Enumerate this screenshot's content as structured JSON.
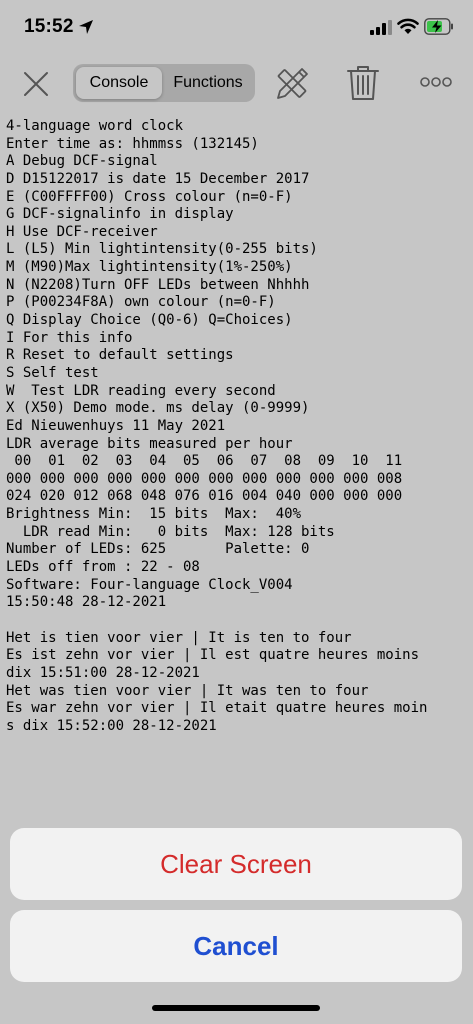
{
  "status": {
    "time": "15:52"
  },
  "toolbar": {
    "tabs": [
      {
        "label": "Console"
      },
      {
        "label": "Functions"
      }
    ],
    "icons": [
      "close-icon",
      "ruler-pencil-icon",
      "trash-icon",
      "more-icon"
    ]
  },
  "console": {
    "lines": [
      "4-language word clock",
      "Enter time as: hhmmss (132145)",
      "A Debug DCF-signal",
      "D D15122017 is date 15 December 2017",
      "E (C00FFFF00) Cross colour (n=0-F)",
      "G DCF-signalinfo in display",
      "H Use DCF-receiver",
      "L (L5) Min lightintensity(0-255 bits)",
      "M (M90)Max lightintensity(1%-250%)",
      "N (N2208)Turn OFF LEDs between Nhhhh",
      "P (P00234F8A) own colour (n=0-F)",
      "Q Display Choice (Q0-6) Q=Choices)",
      "I For this info",
      "R Reset to default settings",
      "S Self test",
      "W  Test LDR reading every second",
      "X (X50) Demo mode. ms delay (0-9999)",
      "Ed Nieuwenhuys 11 May 2021",
      "LDR average bits measured per hour",
      " 00  01  02  03  04  05  06  07  08  09  10  11",
      "000 000 000 000 000 000 000 000 000 000 000 008",
      "024 020 012 068 048 076 016 004 040 000 000 000",
      "Brightness Min:  15 bits  Max:  40%",
      "  LDR read Min:   0 bits  Max: 128 bits",
      "Number of LEDs: 625       Palette: 0",
      "LEDs off from : 22 - 08",
      "Software: Four-language Clock_V004",
      "15:50:48 28-12-2021",
      "",
      "Het is tien voor vier | It is ten to four",
      "Es ist zehn vor vier | Il est quatre heures moins",
      "dix 15:51:00 28-12-2021",
      "Het was tien voor vier | It was ten to four",
      "Es war zehn vor vier | Il etait quatre heures moin",
      "s dix 15:52:00 28-12-2021"
    ]
  },
  "action_sheet": {
    "clear_label": "Clear Screen",
    "cancel_label": "Cancel",
    "clear_color": "#d42b2b",
    "cancel_color": "#1f4fd1"
  }
}
